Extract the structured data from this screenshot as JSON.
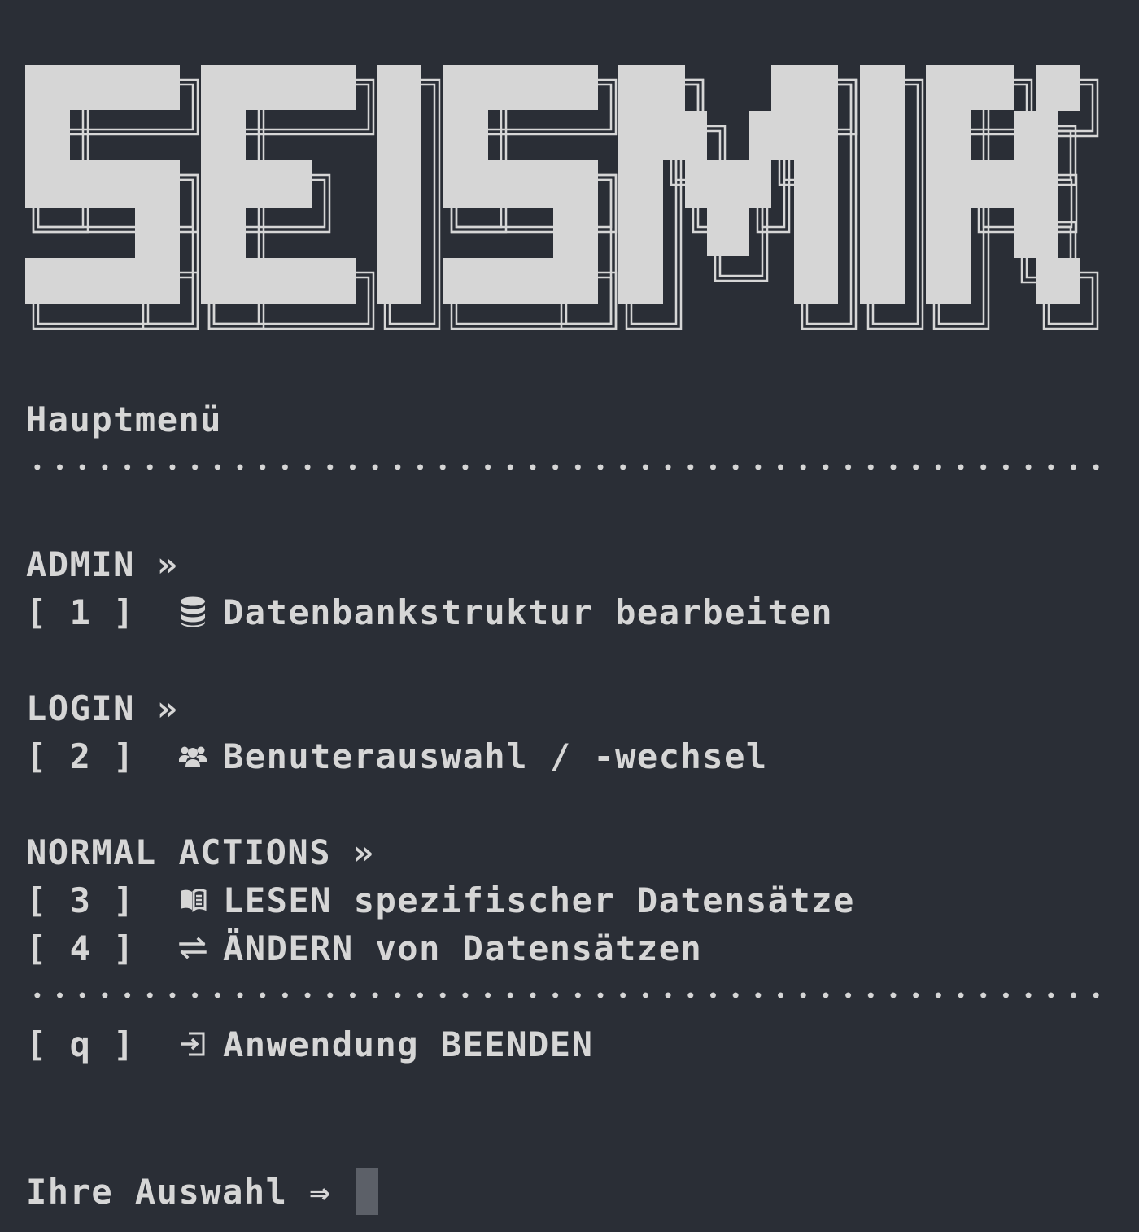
{
  "banner": {
    "title": "SEISMIK"
  },
  "menu": {
    "title": "Hauptmenü",
    "sections": [
      {
        "label": "ADMIN »",
        "items": [
          {
            "key": "[ 1 ]",
            "icon": "database-icon",
            "label": "Datenbankstruktur bearbeiten"
          }
        ]
      },
      {
        "label": "LOGIN »",
        "items": [
          {
            "key": "[ 2 ]",
            "icon": "users-icon",
            "label": "Benuterauswahl / -wechsel"
          }
        ]
      },
      {
        "label": "NORMAL ACTIONS »",
        "items": [
          {
            "key": "[ 3 ]",
            "icon": "book-icon",
            "label": "LESEN spezifischer Datensätze"
          },
          {
            "key": "[ 4 ]",
            "icon": "exchange-icon",
            "label": "ÄNDERN von Datensätzen"
          }
        ]
      }
    ],
    "quit": {
      "key": "[ q ]",
      "icon": "exit-icon",
      "label": "Anwendung BEENDEN"
    }
  },
  "prompt": {
    "label": "Ihre Auswahl ⇒ "
  },
  "colors": {
    "background": "#2a2e36",
    "foreground": "#d6d6d6",
    "cursor": "#5c6068"
  }
}
